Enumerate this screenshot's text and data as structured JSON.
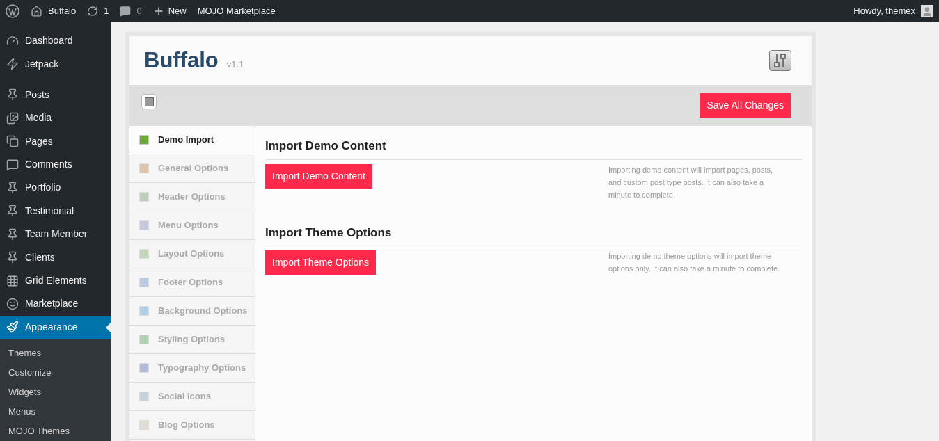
{
  "admin_bar": {
    "site": "Buffalo",
    "updates": "1",
    "comments": "0",
    "new": "New",
    "marketplace": "MOJO Marketplace",
    "greeting": "Howdy, themex"
  },
  "sidebar": {
    "items": [
      {
        "label": "Dashboard",
        "selected": false,
        "gap_after": false
      },
      {
        "label": "Jetpack",
        "selected": false,
        "gap_after": true
      },
      {
        "label": "Posts",
        "selected": false,
        "gap_after": false
      },
      {
        "label": "Media",
        "selected": false,
        "gap_after": false
      },
      {
        "label": "Pages",
        "selected": false,
        "gap_after": false
      },
      {
        "label": "Comments",
        "selected": false,
        "gap_after": false
      },
      {
        "label": "Portfolio",
        "selected": false,
        "gap_after": false
      },
      {
        "label": "Testimonial",
        "selected": false,
        "gap_after": false
      },
      {
        "label": "Team Member",
        "selected": false,
        "gap_after": false
      },
      {
        "label": "Clients",
        "selected": false,
        "gap_after": false
      },
      {
        "label": "Grid Elements",
        "selected": false,
        "gap_after": false
      },
      {
        "label": "Marketplace",
        "selected": false,
        "gap_after": false
      },
      {
        "label": "Appearance",
        "selected": true,
        "gap_after": false
      }
    ],
    "submenu": [
      "Themes",
      "Customize",
      "Widgets",
      "Menus",
      "MOJO Themes"
    ]
  },
  "panel": {
    "title": "Buffalo",
    "version": "v1.1",
    "save_button": "Save All Changes",
    "nav": [
      {
        "label": "Demo Import",
        "selected": true
      },
      {
        "label": "General Options",
        "selected": false
      },
      {
        "label": "Header Options",
        "selected": false
      },
      {
        "label": "Menu Options",
        "selected": false
      },
      {
        "label": "Layout Options",
        "selected": false
      },
      {
        "label": "Footer Options",
        "selected": false
      },
      {
        "label": "Background Options",
        "selected": false
      },
      {
        "label": "Styling Options",
        "selected": false
      },
      {
        "label": "Typography Options",
        "selected": false
      },
      {
        "label": "Social Icons",
        "selected": false
      },
      {
        "label": "Blog Options",
        "selected": false
      }
    ],
    "sections": [
      {
        "heading": "Import Demo Content",
        "button": "Import Demo Content",
        "description": "Importing demo content will import pages, posts, and custom post type posts. It can also take a minute to complete."
      },
      {
        "heading": "Import Theme Options",
        "button": "Import Theme Options",
        "description": "Importing demo theme options will import theme options only. It can also take a minute to complete."
      }
    ]
  }
}
